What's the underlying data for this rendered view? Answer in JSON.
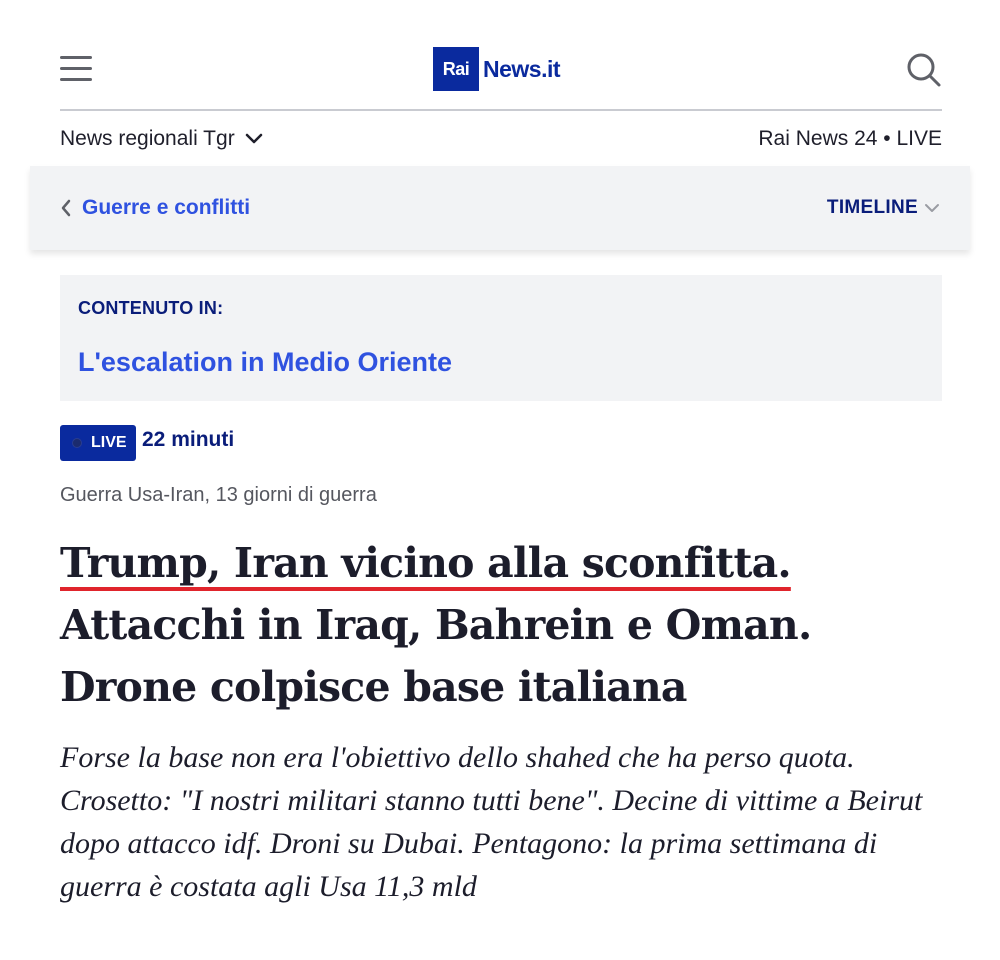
{
  "header": {
    "menu_icon": "hamburger-icon",
    "logo": {
      "part1": "Rai",
      "part2": "News.it"
    },
    "search_icon": "search-icon",
    "regional_label": "News regionali Tgr",
    "live_channel": "Rai News 24 • LIVE"
  },
  "section": {
    "back_label": "Guerre e conflitti",
    "timeline_label": "TIMELINE"
  },
  "content_in": {
    "label": "CONTENUTO IN:",
    "link": "L'escalation in Medio Oriente"
  },
  "live": {
    "badge": "LIVE",
    "time": "22 minuti"
  },
  "article": {
    "kicker": "Guerra Usa-Iran, 13 giorni di guerra",
    "headline_underlined": "Trump, Iran vicino alla sconfitta.",
    "headline_rest": " Attacchi in Iraq, Bahrein e Oman. Drone colpisce base italiana",
    "summary": "Forse la base non era l'obiettivo dello shahed che ha perso quota. Crosetto: \"I nostri militari stanno tutti bene\". Decine di vittime a Beirut dopo attacco idf. Droni su Dubai. Pentagono: la prima settimana di guerra è costata agli Usa 11,3 mld"
  },
  "colors": {
    "brand_blue": "#0a2a9e",
    "link_blue": "#2f52e0",
    "underline_red": "#e0242c"
  }
}
